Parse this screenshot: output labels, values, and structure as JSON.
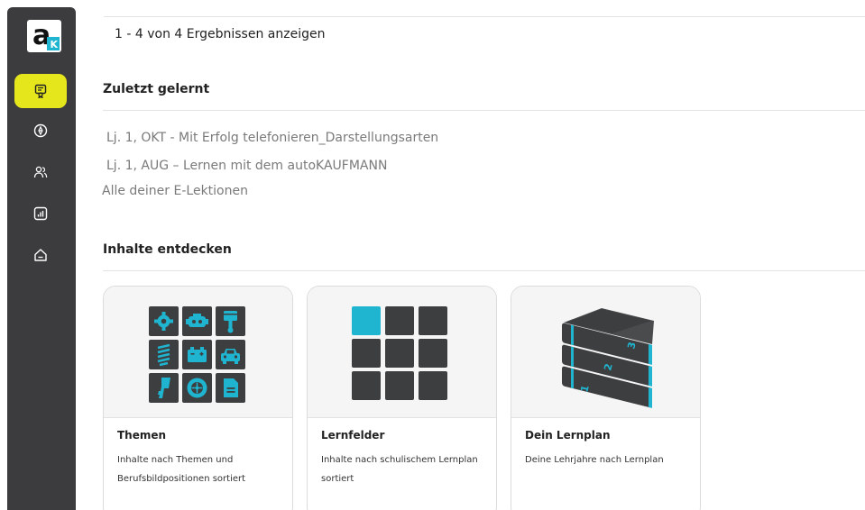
{
  "brand": {
    "logo_letter": "a",
    "logo_badge": "K",
    "accent": "#e6e61c",
    "teal": "#1fb5d0"
  },
  "sidebar": {
    "items": [
      {
        "icon": "certificate-icon",
        "active": true
      },
      {
        "icon": "compass-icon",
        "active": false
      },
      {
        "icon": "users-icon",
        "active": false
      },
      {
        "icon": "chart-icon",
        "active": false
      },
      {
        "icon": "home-icon",
        "active": false
      }
    ]
  },
  "results": {
    "count_text": "1 - 4 von 4 Ergebnissen anzeigen"
  },
  "recent": {
    "title": "Zuletzt gelernt",
    "items": [
      "Lj. 1, OKT - Mit Erfolg telefonieren_Darstellungsarten",
      "Lj. 1, AUG – Lernen mit dem autoKAUFMANN"
    ],
    "all_link": "Alle deiner E-Lektionen"
  },
  "discover": {
    "title": "Inhalte entdecken",
    "cards": [
      {
        "title": "Themen",
        "desc": "Inhalte nach Themen und Berufsbildpositionen sortiert",
        "icons": [
          "gear-icon",
          "engine-icon",
          "piston-icon",
          "spring-icon",
          "battery-icon",
          "car-icon",
          "key-icon",
          "wheel-icon",
          "document-icon"
        ]
      },
      {
        "title": "Lernfelder",
        "desc": "Inhalte nach schulischem Lernplan sortiert"
      },
      {
        "title": "Dein Lernplan",
        "desc": "Deine Lehrjahre nach Lernplan",
        "book_numbers": [
          "1",
          "2",
          "3"
        ]
      }
    ]
  }
}
